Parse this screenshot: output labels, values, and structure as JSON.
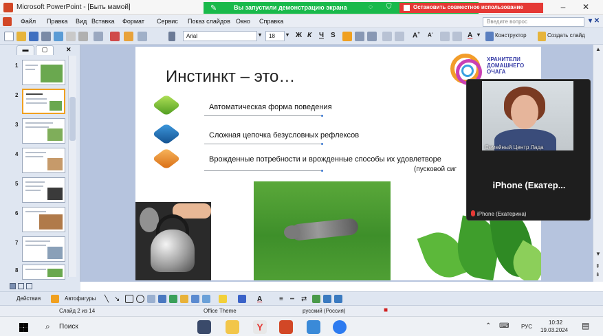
{
  "window": {
    "title": "Microsoft PowerPoint - [Быть мамой]",
    "minimize": "–",
    "restore": "□",
    "close": "✕"
  },
  "share_banner": {
    "icon": "pin-icon",
    "text": "Вы запустили демонстрацию экрана",
    "stop_label": "Остановить совместное использование",
    "color": "#19b94b",
    "stop_color": "#e53935"
  },
  "menu": {
    "items": [
      "Файл",
      "Правка",
      "Вид",
      "Вставка",
      "Формат",
      "Сервис",
      "Показ слайдов",
      "Окно",
      "Справка"
    ],
    "ask_placeholder": "Введите вопрос"
  },
  "toolbar": {
    "font": "Arial",
    "size": "18",
    "bold": "Ж",
    "italic": "К",
    "underline": "Ч",
    "shadow": "S",
    "designer": "Конструктор",
    "new_slide": "Создать слайд"
  },
  "panel": {
    "close": "✕",
    "thumbnails": [
      "1",
      "2",
      "3",
      "4",
      "5",
      "6",
      "7",
      "8"
    ],
    "active_slide": 2
  },
  "slide": {
    "title": "Инстинкт – это…",
    "bullets": [
      "Автоматическая форма поведения",
      "Сложная цепочка безусловных рефлексов",
      "Врожденные потребности и врожденные способы их удовлетворе"
    ],
    "hint": "(пусковой сиг",
    "logo_lines": [
      "ХРАНИТЕЛИ",
      "ДОМАШНЕГО",
      "ОЧАГА"
    ],
    "cube_colors": [
      "#7cc832",
      "#1f6fb8",
      "#f08a24"
    ]
  },
  "camera": {
    "caption": "Семейный Центр Лада",
    "name": "iPhone (Екатер...",
    "footer": "iPhone (Екатерина)"
  },
  "drawbar": {
    "actions": "Действия",
    "autoshapes": "Автофигуры"
  },
  "status": {
    "slide": "Слайд 2 из 14",
    "theme": "Office Theme",
    "language": "русский (Россия)"
  },
  "taskbar": {
    "search": "Поиск",
    "lang": "РУС",
    "time": "10:32",
    "date": "19.03.2024"
  }
}
